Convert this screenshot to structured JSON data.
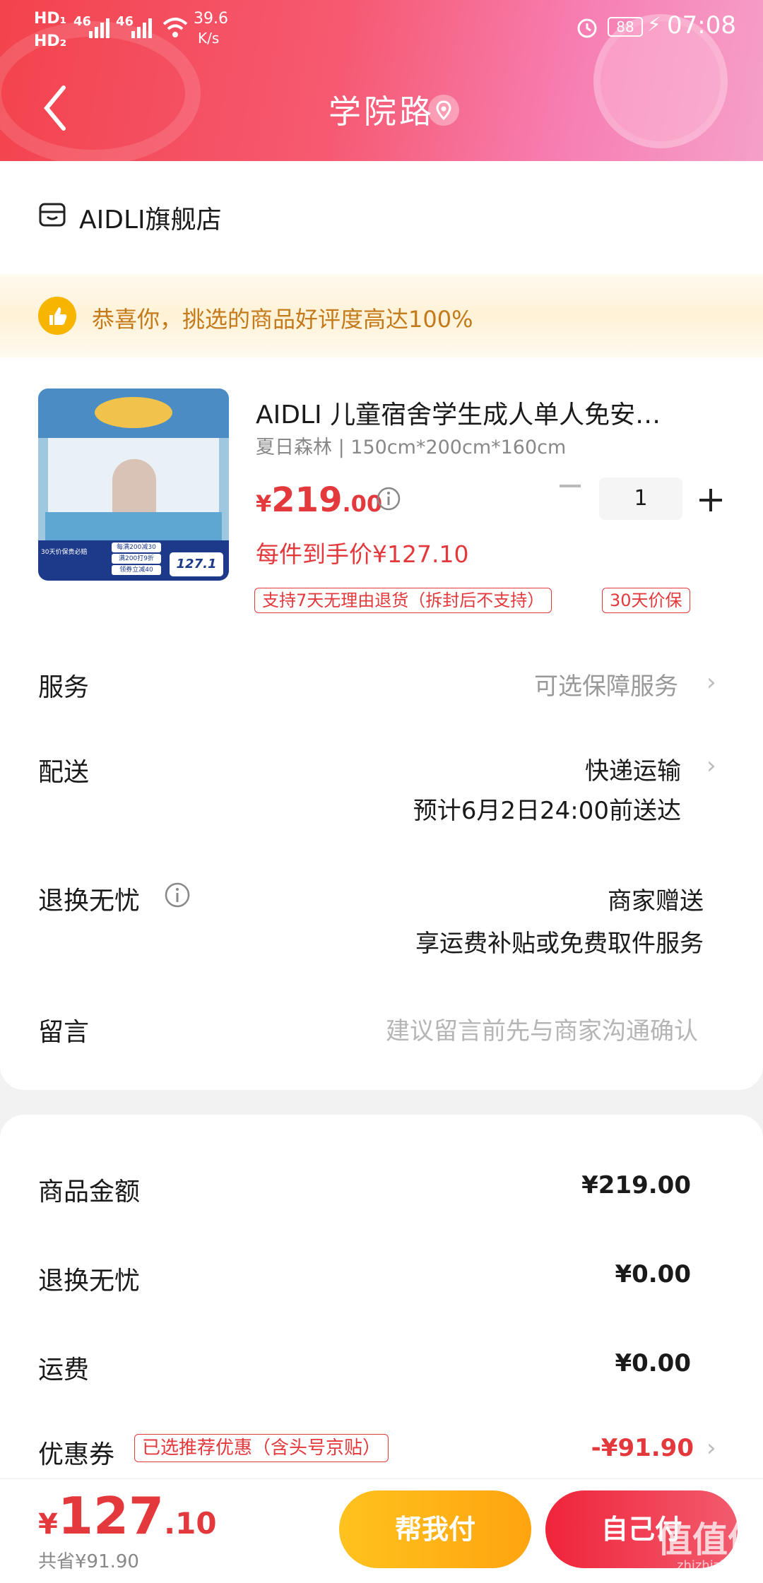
{
  "status_bar": {
    "network_speed": "39.6",
    "network_unit": "K/s",
    "sim1": "46",
    "sim2": "46",
    "battery": "88",
    "time": "07:08"
  },
  "header": {
    "title": "学院路"
  },
  "shop": {
    "name": "AIDLI旗舰店"
  },
  "promo": {
    "text": "恭喜你，挑选的商品好评度高达100%"
  },
  "product": {
    "title": "AIDLI 儿童宿舍学生成人单人免安…",
    "spec": "夏日森林 | 150cm*200cm*160cm",
    "price_symbol": "¥",
    "price_int": "219",
    "price_dec": ".00",
    "net_price_note": "每件到手价¥127.10",
    "quantity": "1",
    "tags": [
      "支持7天无理由退货（拆封后不支持）",
      "30天价保"
    ],
    "image_overlay": {
      "promo1": "每满200减30",
      "promo2": "满200打9折",
      "promo3": "领券立减40",
      "banner": "30天价保贵必赔",
      "price": "127.1"
    }
  },
  "rows": {
    "service": {
      "label": "服务",
      "value": "可选保障服务"
    },
    "delivery": {
      "label": "配送",
      "value": "快递运输",
      "eta": "预计6月2日24:00前送达"
    },
    "return": {
      "label": "退换无忧",
      "value": "商家赠送",
      "detail": "享运费补贴或免费取件服务"
    },
    "message": {
      "label": "留言",
      "placeholder": "建议留言前先与商家沟通确认"
    }
  },
  "summary": {
    "goods": {
      "label": "商品金额",
      "value": "¥219.00"
    },
    "return": {
      "label": "退换无忧",
      "value": "¥0.00"
    },
    "shipping": {
      "label": "运费",
      "value": "¥0.00"
    },
    "coupon": {
      "label": "优惠券",
      "tag": "已选推荐优惠（含头号京贴）",
      "value": "-¥91.90"
    }
  },
  "bottom": {
    "symbol": "¥",
    "total_int": "127",
    "total_dec": ".10",
    "saved": "共省¥91.90",
    "pay_help": "帮我付",
    "pay_self": "自己付"
  },
  "watermark": {
    "text": "值值值",
    "sub": "zhizhizhi.com"
  },
  "colors": {
    "accent": "#e4393c",
    "header_start": "#f3434d",
    "header_end": "#f5a0c8",
    "help_button": "#ffb316"
  }
}
